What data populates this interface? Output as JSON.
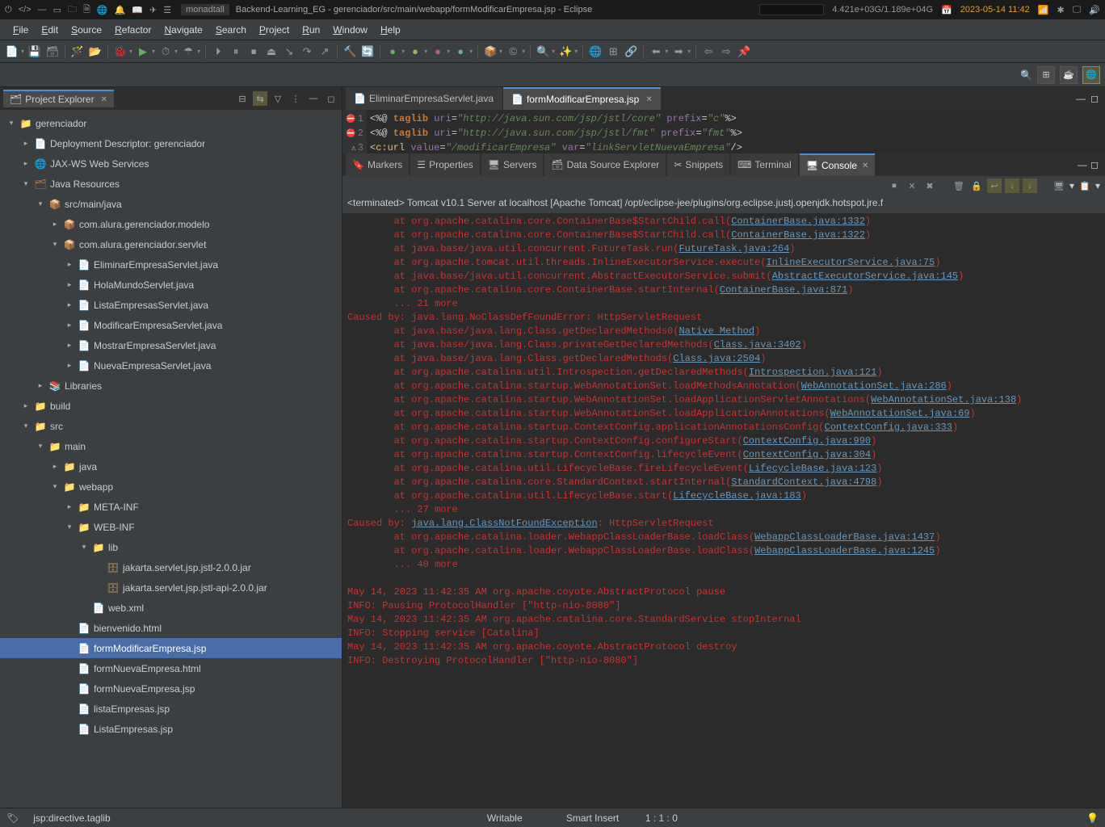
{
  "topbar": {
    "wm": "monadtall",
    "title": "Backend-Learning_EG - gerenciador/src/main/webapp/formModificarEmpresa.jsp - Eclipse",
    "resource": "4.421e+03G/1.189e+04G",
    "datetime": "2023-05-14 11:42"
  },
  "menu": [
    "File",
    "Edit",
    "Source",
    "Refactor",
    "Navigate",
    "Search",
    "Project",
    "Run",
    "Window",
    "Help"
  ],
  "projectExplorer": {
    "title": "Project Explorer"
  },
  "tree": [
    {
      "depth": 0,
      "twisty": "▾",
      "icon": "📁",
      "cls": "folder-icon",
      "label": "gerenciador"
    },
    {
      "depth": 1,
      "twisty": "▸",
      "icon": "📄",
      "cls": "",
      "label": "Deployment Descriptor: gerenciador"
    },
    {
      "depth": 1,
      "twisty": "▸",
      "icon": "🌐",
      "cls": "",
      "label": "JAX-WS Web Services"
    },
    {
      "depth": 1,
      "twisty": "▾",
      "icon": "🗂",
      "cls": "pkg-icon",
      "label": "Java Resources"
    },
    {
      "depth": 2,
      "twisty": "▾",
      "icon": "📦",
      "cls": "pkg-icon",
      "label": "src/main/java"
    },
    {
      "depth": 3,
      "twisty": "▸",
      "icon": "📦",
      "cls": "pkg-icon",
      "label": "com.alura.gerenciador.modelo"
    },
    {
      "depth": 3,
      "twisty": "▾",
      "icon": "📦",
      "cls": "pkg-icon",
      "label": "com.alura.gerenciador.servlet"
    },
    {
      "depth": 4,
      "twisty": "▸",
      "icon": "📄",
      "cls": "java-icon",
      "label": "EliminarEmpresaServlet.java"
    },
    {
      "depth": 4,
      "twisty": "▸",
      "icon": "📄",
      "cls": "java-icon",
      "label": "HolaMundoServlet.java"
    },
    {
      "depth": 4,
      "twisty": "▸",
      "icon": "📄",
      "cls": "java-icon",
      "label": "ListaEmpresasServlet.java"
    },
    {
      "depth": 4,
      "twisty": "▸",
      "icon": "📄",
      "cls": "java-icon",
      "label": "ModificarEmpresaServlet.java"
    },
    {
      "depth": 4,
      "twisty": "▸",
      "icon": "📄",
      "cls": "java-icon",
      "label": "MostrarEmpresaServlet.java"
    },
    {
      "depth": 4,
      "twisty": "▸",
      "icon": "📄",
      "cls": "java-icon",
      "label": "NuevaEmpresaServlet.java"
    },
    {
      "depth": 2,
      "twisty": "▸",
      "icon": "📚",
      "cls": "",
      "label": "Libraries"
    },
    {
      "depth": 1,
      "twisty": "▸",
      "icon": "📁",
      "cls": "folder-icon",
      "label": "build"
    },
    {
      "depth": 1,
      "twisty": "▾",
      "icon": "📁",
      "cls": "folder-icon",
      "label": "src"
    },
    {
      "depth": 2,
      "twisty": "▾",
      "icon": "📁",
      "cls": "folder-icon",
      "label": "main"
    },
    {
      "depth": 3,
      "twisty": "▸",
      "icon": "📁",
      "cls": "folder-icon",
      "label": "java"
    },
    {
      "depth": 3,
      "twisty": "▾",
      "icon": "📁",
      "cls": "folder-icon",
      "label": "webapp"
    },
    {
      "depth": 4,
      "twisty": "▸",
      "icon": "📁",
      "cls": "folder-icon",
      "label": "META-INF"
    },
    {
      "depth": 4,
      "twisty": "▾",
      "icon": "📁",
      "cls": "folder-icon",
      "label": "WEB-INF"
    },
    {
      "depth": 5,
      "twisty": "▾",
      "icon": "📁",
      "cls": "folder-icon",
      "label": "lib"
    },
    {
      "depth": 6,
      "twisty": "",
      "icon": "🗄",
      "cls": "jar-icon",
      "label": "jakarta.servlet.jsp.jstl-2.0.0.jar"
    },
    {
      "depth": 6,
      "twisty": "",
      "icon": "🗄",
      "cls": "jar-icon",
      "label": "jakarta.servlet.jsp.jstl-api-2.0.0.jar"
    },
    {
      "depth": 5,
      "twisty": "",
      "icon": "📄",
      "cls": "xml-icon",
      "label": "web.xml"
    },
    {
      "depth": 4,
      "twisty": "",
      "icon": "📄",
      "cls": "html-icon",
      "label": "bienvenido.html"
    },
    {
      "depth": 4,
      "twisty": "",
      "icon": "📄",
      "cls": "jsp-icon",
      "label": "formModificarEmpresa.jsp",
      "selected": true
    },
    {
      "depth": 4,
      "twisty": "",
      "icon": "📄",
      "cls": "html-icon",
      "label": "formNuevaEmpresa.html"
    },
    {
      "depth": 4,
      "twisty": "",
      "icon": "📄",
      "cls": "jsp-icon",
      "label": "formNuevaEmpresa.jsp"
    },
    {
      "depth": 4,
      "twisty": "",
      "icon": "📄",
      "cls": "jsp-icon",
      "label": "listaEmpresas.jsp"
    },
    {
      "depth": 4,
      "twisty": "",
      "icon": "📄",
      "cls": "jsp-icon",
      "label": "ListaEmpresas.jsp"
    }
  ],
  "editorTabs": [
    {
      "label": "EliminarEmpresaServlet.java",
      "active": false,
      "icon": "📄"
    },
    {
      "label": "formModificarEmpresa.jsp",
      "active": true,
      "icon": "📄"
    }
  ],
  "editorLines": {
    "l1": {
      "num": "1",
      "err": true
    },
    "l2": {
      "num": "2",
      "err": true
    },
    "l3": {
      "num": "3",
      "warn": true
    }
  },
  "code": {
    "l1a": "<%@",
    "l1b": " taglib",
    "l1c": " uri",
    "l1d": "=",
    "l1e": "\"http://java.sun.com/jsp/jstl/core\"",
    "l1f": " prefix",
    "l1g": "=",
    "l1h": "\"c\"",
    "l1i": "%>",
    "l2a": "<%@",
    "l2b": " taglib",
    "l2c": " uri",
    "l2d": "=",
    "l2e": "\"http://java.sun.com/jsp/jstl/fmt\"",
    "l2f": " prefix",
    "l2g": "=",
    "l2h": "\"fmt\"",
    "l2i": "%>",
    "l3a": "<",
    "l3b": "c:url",
    "l3c": " value",
    "l3d": "=",
    "l3e": "\"/modificarEmpresa\"",
    "l3f": " var",
    "l3g": "=",
    "l3h": "\"linkServletNuevaEmpresa\"",
    "l3i": "/>"
  },
  "bottomTabs": [
    {
      "label": "Markers",
      "active": false,
      "icon": "🔖"
    },
    {
      "label": "Properties",
      "active": false,
      "icon": "☰"
    },
    {
      "label": "Servers",
      "active": false,
      "icon": "🖥"
    },
    {
      "label": "Data Source Explorer",
      "active": false,
      "icon": "🗃"
    },
    {
      "label": "Snippets",
      "active": false,
      "icon": "✂"
    },
    {
      "label": "Terminal",
      "active": false,
      "icon": "⌨"
    },
    {
      "label": "Console",
      "active": true,
      "icon": "🖥"
    }
  ],
  "consoleHeader": "<terminated> Tomcat v10.1 Server at localhost [Apache Tomcat] /opt/eclipse-jee/plugins/org.eclipse.justj.openjdk.hotspot.jre.f",
  "console": [
    {
      "t": "st",
      "pre": "        at org.apache.catalina.core.ContainerBase$StartChild.call(",
      "link": "ContainerBase.java:1332",
      "post": ")"
    },
    {
      "t": "st",
      "pre": "        at org.apache.catalina.core.ContainerBase$StartChild.call(",
      "link": "ContainerBase.java:1322",
      "post": ")"
    },
    {
      "t": "st",
      "pre": "        at java.base/java.util.concurrent.FutureTask.run(",
      "link": "FutureTask.java:264",
      "post": ")"
    },
    {
      "t": "st",
      "pre": "        at org.apache.tomcat.util.threads.InlineExecutorService.execute(",
      "link": "InlineExecutorService.java:75",
      "post": ")"
    },
    {
      "t": "st",
      "pre": "        at java.base/java.util.concurrent.AbstractExecutorService.submit(",
      "link": "AbstractExecutorService.java:145",
      "post": ")"
    },
    {
      "t": "st",
      "pre": "        at org.apache.catalina.core.ContainerBase.startInternal(",
      "link": "ContainerBase.java:871",
      "post": ")"
    },
    {
      "t": "st",
      "pre": "        ... 21 more",
      "link": "",
      "post": ""
    },
    {
      "t": "err",
      "pre": "Caused by: java.lang.NoClassDefFoundError: HttpServletRequest",
      "link": "",
      "post": ""
    },
    {
      "t": "st",
      "pre": "        at java.base/java.lang.Class.getDeclaredMethods0(",
      "link": "Native Method",
      "post": ")"
    },
    {
      "t": "st",
      "pre": "        at java.base/java.lang.Class.privateGetDeclaredMethods(",
      "link": "Class.java:3402",
      "post": ")"
    },
    {
      "t": "st",
      "pre": "        at java.base/java.lang.Class.getDeclaredMethods(",
      "link": "Class.java:2504",
      "post": ")"
    },
    {
      "t": "st",
      "pre": "        at org.apache.catalina.util.Introspection.getDeclaredMethods(",
      "link": "Introspection.java:121",
      "post": ")"
    },
    {
      "t": "st",
      "pre": "        at org.apache.catalina.startup.WebAnnotationSet.loadMethodsAnnotation(",
      "link": "WebAnnotationSet.java:286",
      "post": ")"
    },
    {
      "t": "st",
      "pre": "        at org.apache.catalina.startup.WebAnnotationSet.loadApplicationServletAnnotations(",
      "link": "WebAnnotationSet.java:138",
      "post": ")"
    },
    {
      "t": "st",
      "pre": "        at org.apache.catalina.startup.WebAnnotationSet.loadApplicationAnnotations(",
      "link": "WebAnnotationSet.java:69",
      "post": ")"
    },
    {
      "t": "st",
      "pre": "        at org.apache.catalina.startup.ContextConfig.applicationAnnotationsConfig(",
      "link": "ContextConfig.java:333",
      "post": ")"
    },
    {
      "t": "st",
      "pre": "        at org.apache.catalina.startup.ContextConfig.configureStart(",
      "link": "ContextConfig.java:990",
      "post": ")"
    },
    {
      "t": "st",
      "pre": "        at org.apache.catalina.startup.ContextConfig.lifecycleEvent(",
      "link": "ContextConfig.java:304",
      "post": ")"
    },
    {
      "t": "st",
      "pre": "        at org.apache.catalina.util.LifecycleBase.fireLifecycleEvent(",
      "link": "LifecycleBase.java:123",
      "post": ")"
    },
    {
      "t": "st",
      "pre": "        at org.apache.catalina.core.StandardContext.startInternal(",
      "link": "StandardContext.java:4798",
      "post": ")"
    },
    {
      "t": "st",
      "pre": "        at org.apache.catalina.util.LifecycleBase.start(",
      "link": "LifecycleBase.java:183",
      "post": ")"
    },
    {
      "t": "st",
      "pre": "        ... 27 more",
      "link": "",
      "post": ""
    },
    {
      "t": "err",
      "pre": "Caused by: ",
      "link": "java.lang.ClassNotFoundException",
      "post": ": HttpServletRequest"
    },
    {
      "t": "st",
      "pre": "        at org.apache.catalina.loader.WebappClassLoaderBase.loadClass(",
      "link": "WebappClassLoaderBase.java:1437",
      "post": ")"
    },
    {
      "t": "st",
      "pre": "        at org.apache.catalina.loader.WebappClassLoaderBase.loadClass(",
      "link": "WebappClassLoaderBase.java:1245",
      "post": ")"
    },
    {
      "t": "st",
      "pre": "        ... 40 more",
      "link": "",
      "post": ""
    },
    {
      "t": "blank",
      "pre": "",
      "link": "",
      "post": ""
    },
    {
      "t": "info",
      "pre": "May 14, 2023 11:42:35 AM org.apache.coyote.AbstractProtocol pause",
      "link": "",
      "post": ""
    },
    {
      "t": "info",
      "pre": "INFO: Pausing ProtocolHandler [\"http-nio-8080\"]",
      "link": "",
      "post": ""
    },
    {
      "t": "info",
      "pre": "May 14, 2023 11:42:35 AM org.apache.catalina.core.StandardService stopInternal",
      "link": "",
      "post": ""
    },
    {
      "t": "info",
      "pre": "INFO: Stopping service [Catalina]",
      "link": "",
      "post": ""
    },
    {
      "t": "info",
      "pre": "May 14, 2023 11:42:35 AM org.apache.coyote.AbstractProtocol destroy",
      "link": "",
      "post": ""
    },
    {
      "t": "info",
      "pre": "INFO: Destroying ProtocolHandler [\"http-nio-8080\"]",
      "link": "",
      "post": ""
    }
  ],
  "status": {
    "context": "jsp:directive.taglib",
    "writable": "Writable",
    "insert": "Smart Insert",
    "cursor": "1 : 1 : 0"
  }
}
